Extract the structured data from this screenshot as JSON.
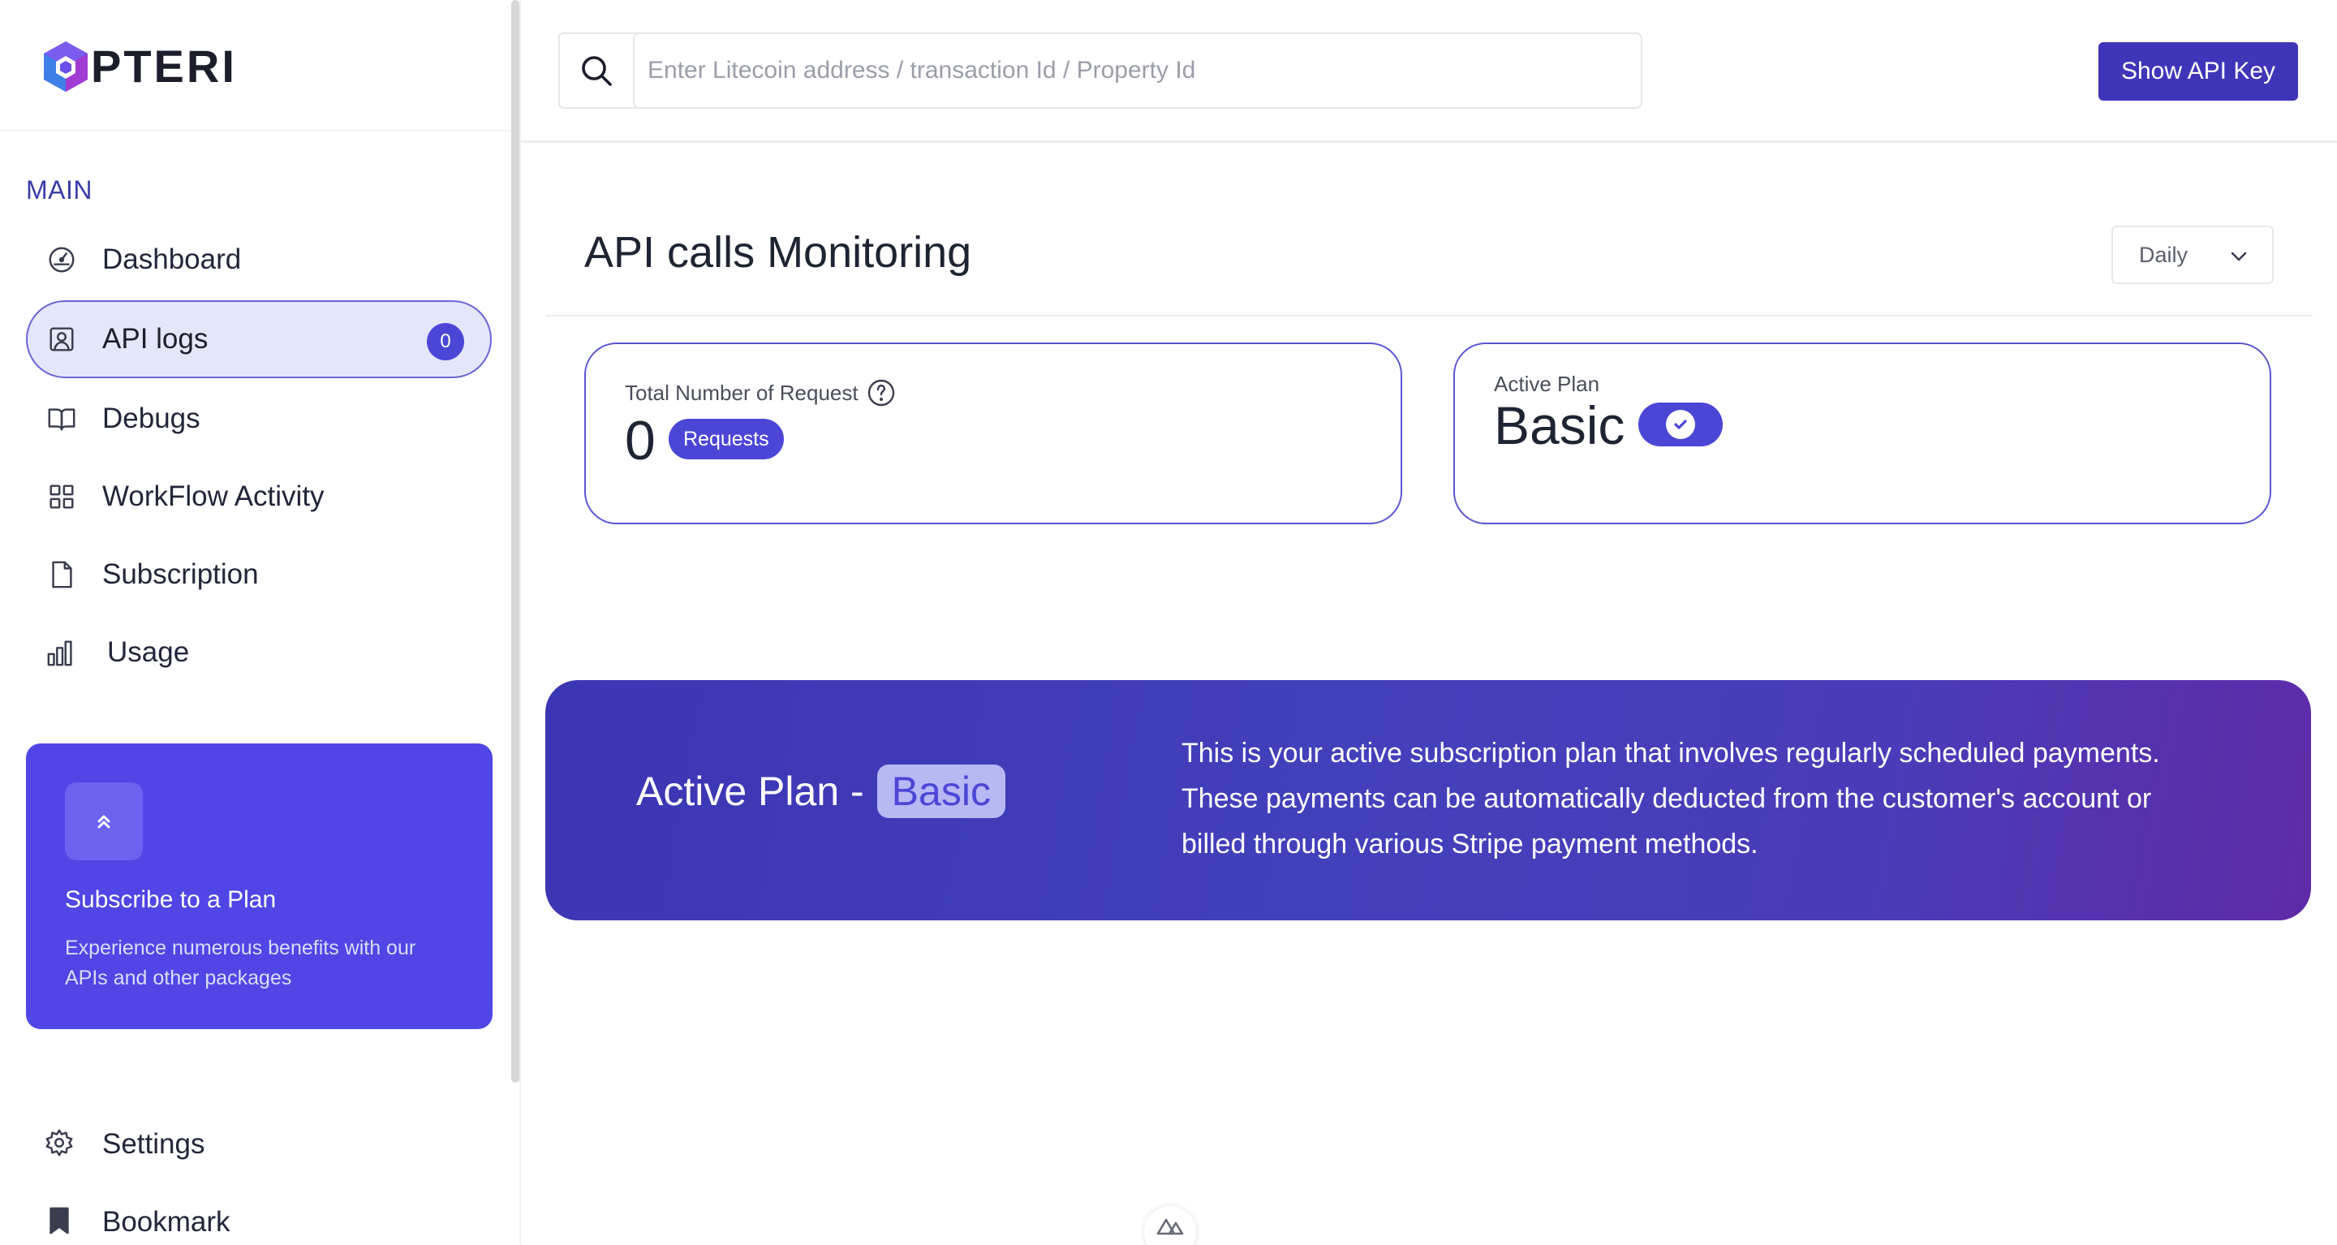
{
  "brand": {
    "name": "PTERI"
  },
  "sidebar": {
    "section_title": "MAIN",
    "items": [
      {
        "label": "Dashboard",
        "icon": "dashboard-gauge-icon"
      },
      {
        "label": "API logs",
        "icon": "user-square-icon",
        "badge": "0",
        "active": true
      },
      {
        "label": "Debugs",
        "icon": "book-open-icon"
      },
      {
        "label": "WorkFlow Activity",
        "icon": "grid-icon"
      },
      {
        "label": "Subscription",
        "icon": "document-icon"
      },
      {
        "label": "Usage",
        "icon": "bar-chart-icon"
      }
    ],
    "promo": {
      "title": "Subscribe to a Plan",
      "text": "Experience numerous benefits with our APIs and other packages",
      "icon": "chevrons-up-icon"
    },
    "bottom": [
      {
        "label": "Settings",
        "icon": "gear-icon"
      },
      {
        "label": "Bookmark",
        "icon": "bookmark-icon"
      }
    ]
  },
  "topbar": {
    "search_placeholder": "Enter Litecoin address / transaction Id / Property Id",
    "api_key_button": "Show API Key"
  },
  "main": {
    "title": "API calls Monitoring",
    "period": "Daily",
    "total_requests": {
      "label": "Total Number of Request",
      "value": "0",
      "unit": "Requests"
    },
    "active_plan": {
      "label": "Active Plan",
      "value": "Basic"
    },
    "banner": {
      "title_prefix": "Active Plan -",
      "plan": "Basic",
      "text": "This is your active subscription plan that involves regularly scheduled payments. These payments can be automatically deducted from the customer's account or billed through various Stripe payment methods."
    }
  },
  "colors": {
    "accent": "#4c46d7",
    "button": "#3f35b8",
    "banner_start": "#3b36b3",
    "banner_end": "#5f2aa8",
    "active_nav_bg": "#e4e6fc"
  }
}
